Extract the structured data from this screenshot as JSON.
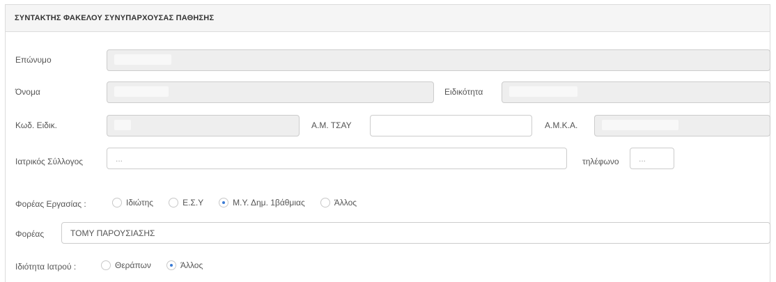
{
  "panel": {
    "title": "ΣΥΝΤΑΚΤΗΣ ΦΑΚΕΛΟΥ ΣΥΝΥΠΑΡΧΟΥΣΑΣ ΠΑΘΗΣΗΣ"
  },
  "fields": {
    "surname": {
      "label": "Επώνυμο",
      "value": ""
    },
    "name": {
      "label": "Όνομα",
      "value": ""
    },
    "specialty": {
      "label": "Ειδικότητα",
      "value": ""
    },
    "specialty_code": {
      "label": "Κωδ. Ειδικ.",
      "value": ""
    },
    "am_tsay": {
      "label": "Α.Μ. ΤΣΑΥ",
      "value": ""
    },
    "amka": {
      "label": "Α.Μ.Κ.Α.",
      "value": ""
    },
    "medical_association": {
      "label": "Ιατρικός Σύλλογος",
      "placeholder": "..."
    },
    "phone": {
      "label": "τηλέφωνο",
      "placeholder": "..."
    },
    "organization": {
      "label": "Φορέας",
      "value": "ΤΟΜΥ ΠΑΡΟΥΣΙΑΣΗΣ"
    }
  },
  "employment": {
    "label": "Φορέας Εργασίας :",
    "options": [
      "Ιδιώτης",
      "Ε.Σ.Υ",
      "Μ.Υ. Δημ. 1βάθμιας",
      "Άλλος"
    ],
    "selected": "Μ.Υ. Δημ. 1βάθμιας"
  },
  "doctor_role": {
    "label": "Ιδιότητα Ιατρού :",
    "options": [
      "Θεράπων",
      "Άλλος"
    ],
    "selected": "Άλλος"
  },
  "colors": {
    "radio_accent": "#3a7bd5",
    "header_bg": "#f5f5f5",
    "readonly_bg": "#eeeeee"
  }
}
